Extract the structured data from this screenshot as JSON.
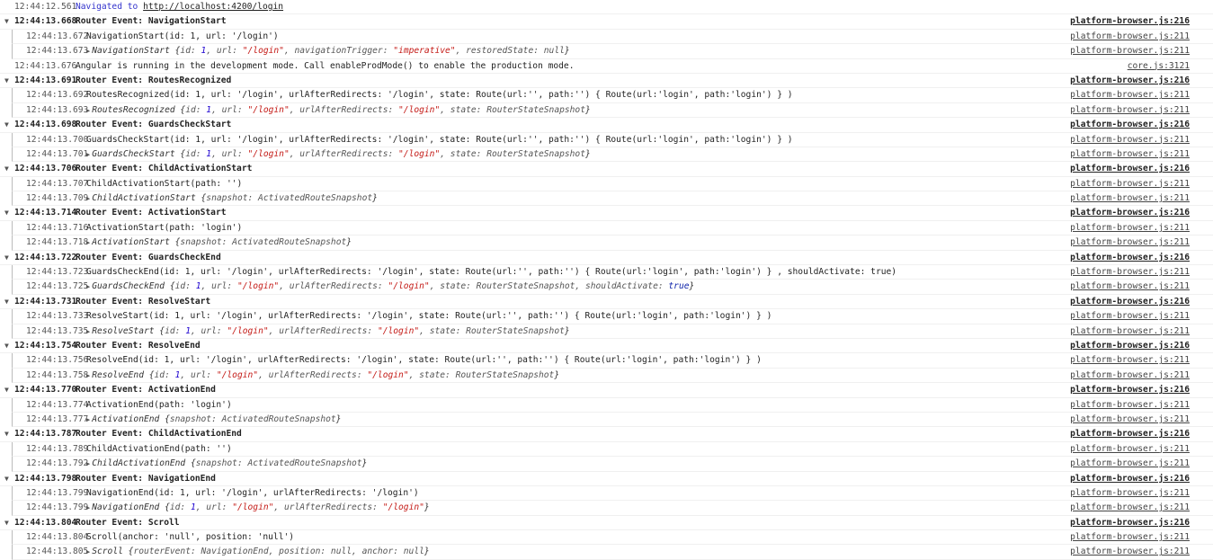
{
  "nav": {
    "ts": "12:44:12.561",
    "text": "Navigated to ",
    "url": "http://localhost:4200/login"
  },
  "rows": [
    {
      "kind": "grp",
      "ts": "12:44:13.668",
      "title": "Router Event: NavigationStart",
      "src": "platform-browser.js:216"
    },
    {
      "kind": "child",
      "ts": "12:44:13.672",
      "msg": "NavigationStart(id: 1, url: '/login')",
      "src": "platform-browser.js:211"
    },
    {
      "kind": "obj",
      "ts": "12:44:13.673",
      "name": "NavigationStart",
      "parts": [
        [
          "k",
          "id: "
        ],
        [
          "n",
          "1"
        ],
        [
          "k",
          ", url: "
        ],
        [
          "s",
          "\"/login\""
        ],
        [
          "k",
          ", navigationTrigger: "
        ],
        [
          "s",
          "\"imperative\""
        ],
        [
          "k",
          ", restoredState: null"
        ]
      ],
      "src": "platform-browser.js:211"
    },
    {
      "kind": "plain",
      "ts": "12:44:13.676",
      "msg": "Angular is running in the development mode. Call enableProdMode() to enable the production mode.",
      "src": "core.js:3121"
    },
    {
      "kind": "grp",
      "ts": "12:44:13.691",
      "title": "Router Event: RoutesRecognized",
      "src": "platform-browser.js:216"
    },
    {
      "kind": "child",
      "ts": "12:44:13.692",
      "msg": "RoutesRecognized(id: 1, url: '/login', urlAfterRedirects: '/login', state: Route(url:'', path:'') { Route(url:'login', path:'login') } )",
      "src": "platform-browser.js:211"
    },
    {
      "kind": "obj",
      "ts": "12:44:13.693",
      "name": "RoutesRecognized",
      "parts": [
        [
          "k",
          "id: "
        ],
        [
          "n",
          "1"
        ],
        [
          "k",
          ", url: "
        ],
        [
          "s",
          "\"/login\""
        ],
        [
          "k",
          ", urlAfterRedirects: "
        ],
        [
          "s",
          "\"/login\""
        ],
        [
          "k",
          ", state: RouterStateSnapshot"
        ]
      ],
      "src": "platform-browser.js:211"
    },
    {
      "kind": "grp",
      "ts": "12:44:13.698",
      "title": "Router Event: GuardsCheckStart",
      "src": "platform-browser.js:216"
    },
    {
      "kind": "child",
      "ts": "12:44:13.700",
      "msg": "GuardsCheckStart(id: 1, url: '/login', urlAfterRedirects: '/login', state: Route(url:'', path:'') { Route(url:'login', path:'login') } )",
      "src": "platform-browser.js:211"
    },
    {
      "kind": "obj",
      "ts": "12:44:13.701",
      "name": "GuardsCheckStart",
      "parts": [
        [
          "k",
          "id: "
        ],
        [
          "n",
          "1"
        ],
        [
          "k",
          ", url: "
        ],
        [
          "s",
          "\"/login\""
        ],
        [
          "k",
          ", urlAfterRedirects: "
        ],
        [
          "s",
          "\"/login\""
        ],
        [
          "k",
          ", state: RouterStateSnapshot"
        ]
      ],
      "src": "platform-browser.js:211"
    },
    {
      "kind": "grp",
      "ts": "12:44:13.706",
      "title": "Router Event: ChildActivationStart",
      "src": "platform-browser.js:216"
    },
    {
      "kind": "child",
      "ts": "12:44:13.707",
      "msg": "ChildActivationStart(path: '')",
      "src": "platform-browser.js:211"
    },
    {
      "kind": "obj",
      "ts": "12:44:13.709",
      "name": "ChildActivationStart",
      "parts": [
        [
          "k",
          "snapshot: ActivatedRouteSnapshot"
        ]
      ],
      "src": "platform-browser.js:211"
    },
    {
      "kind": "grp",
      "ts": "12:44:13.714",
      "title": "Router Event: ActivationStart",
      "src": "platform-browser.js:216"
    },
    {
      "kind": "child",
      "ts": "12:44:13.716",
      "msg": "ActivationStart(path: 'login')",
      "src": "platform-browser.js:211"
    },
    {
      "kind": "obj",
      "ts": "12:44:13.718",
      "name": "ActivationStart",
      "parts": [
        [
          "k",
          "snapshot: ActivatedRouteSnapshot"
        ]
      ],
      "src": "platform-browser.js:211"
    },
    {
      "kind": "grp",
      "ts": "12:44:13.722",
      "title": "Router Event: GuardsCheckEnd",
      "src": "platform-browser.js:216"
    },
    {
      "kind": "child",
      "ts": "12:44:13.723",
      "msg": "GuardsCheckEnd(id: 1, url: '/login', urlAfterRedirects: '/login', state: Route(url:'', path:'') { Route(url:'login', path:'login') } , shouldActivate: true)",
      "src": "platform-browser.js:211"
    },
    {
      "kind": "obj",
      "ts": "12:44:13.725",
      "name": "GuardsCheckEnd",
      "parts": [
        [
          "k",
          "id: "
        ],
        [
          "n",
          "1"
        ],
        [
          "k",
          ", url: "
        ],
        [
          "s",
          "\"/login\""
        ],
        [
          "k",
          ", urlAfterRedirects: "
        ],
        [
          "s",
          "\"/login\""
        ],
        [
          "k",
          ", state: RouterStateSnapshot, shouldActivate: "
        ],
        [
          "b",
          "true"
        ]
      ],
      "src": "platform-browser.js:211"
    },
    {
      "kind": "grp",
      "ts": "12:44:13.731",
      "title": "Router Event: ResolveStart",
      "src": "platform-browser.js:216"
    },
    {
      "kind": "child",
      "ts": "12:44:13.733",
      "msg": "ResolveStart(id: 1, url: '/login', urlAfterRedirects: '/login', state: Route(url:'', path:'') { Route(url:'login', path:'login') } )",
      "src": "platform-browser.js:211"
    },
    {
      "kind": "obj",
      "ts": "12:44:13.735",
      "name": "ResolveStart",
      "parts": [
        [
          "k",
          "id: "
        ],
        [
          "n",
          "1"
        ],
        [
          "k",
          ", url: "
        ],
        [
          "s",
          "\"/login\""
        ],
        [
          "k",
          ", urlAfterRedirects: "
        ],
        [
          "s",
          "\"/login\""
        ],
        [
          "k",
          ", state: RouterStateSnapshot"
        ]
      ],
      "src": "platform-browser.js:211"
    },
    {
      "kind": "grp",
      "ts": "12:44:13.754",
      "title": "Router Event: ResolveEnd",
      "src": "platform-browser.js:216"
    },
    {
      "kind": "child",
      "ts": "12:44:13.756",
      "msg": "ResolveEnd(id: 1, url: '/login', urlAfterRedirects: '/login', state: Route(url:'', path:'') { Route(url:'login', path:'login') } )",
      "src": "platform-browser.js:211"
    },
    {
      "kind": "obj",
      "ts": "12:44:13.758",
      "name": "ResolveEnd",
      "parts": [
        [
          "k",
          "id: "
        ],
        [
          "n",
          "1"
        ],
        [
          "k",
          ", url: "
        ],
        [
          "s",
          "\"/login\""
        ],
        [
          "k",
          ", urlAfterRedirects: "
        ],
        [
          "s",
          "\"/login\""
        ],
        [
          "k",
          ", state: RouterStateSnapshot"
        ]
      ],
      "src": "platform-browser.js:211"
    },
    {
      "kind": "grp",
      "ts": "12:44:13.770",
      "title": "Router Event: ActivationEnd",
      "src": "platform-browser.js:216"
    },
    {
      "kind": "child",
      "ts": "12:44:13.774",
      "msg": "ActivationEnd(path: 'login')",
      "src": "platform-browser.js:211"
    },
    {
      "kind": "obj",
      "ts": "12:44:13.777",
      "name": "ActivationEnd",
      "parts": [
        [
          "k",
          "snapshot: ActivatedRouteSnapshot"
        ]
      ],
      "src": "platform-browser.js:211"
    },
    {
      "kind": "grp",
      "ts": "12:44:13.787",
      "title": "Router Event: ChildActivationEnd",
      "src": "platform-browser.js:216"
    },
    {
      "kind": "child",
      "ts": "12:44:13.789",
      "msg": "ChildActivationEnd(path: '')",
      "src": "platform-browser.js:211"
    },
    {
      "kind": "obj",
      "ts": "12:44:13.792",
      "name": "ChildActivationEnd",
      "parts": [
        [
          "k",
          "snapshot: ActivatedRouteSnapshot"
        ]
      ],
      "src": "platform-browser.js:211"
    },
    {
      "kind": "grp",
      "ts": "12:44:13.798",
      "title": "Router Event: NavigationEnd",
      "src": "platform-browser.js:216"
    },
    {
      "kind": "child",
      "ts": "12:44:13.799",
      "msg": "NavigationEnd(id: 1, url: '/login', urlAfterRedirects: '/login')",
      "src": "platform-browser.js:211"
    },
    {
      "kind": "obj",
      "ts": "12:44:13.799",
      "name": "NavigationEnd",
      "parts": [
        [
          "k",
          "id: "
        ],
        [
          "n",
          "1"
        ],
        [
          "k",
          ", url: "
        ],
        [
          "s",
          "\"/login\""
        ],
        [
          "k",
          ", urlAfterRedirects: "
        ],
        [
          "s",
          "\"/login\""
        ]
      ],
      "src": "platform-browser.js:211"
    },
    {
      "kind": "grp",
      "ts": "12:44:13.804",
      "title": "Router Event: Scroll",
      "src": "platform-browser.js:216"
    },
    {
      "kind": "child",
      "ts": "12:44:13.804",
      "msg": "Scroll(anchor: 'null', position: 'null')",
      "src": "platform-browser.js:211"
    },
    {
      "kind": "obj",
      "ts": "12:44:13.805",
      "name": "Scroll",
      "parts": [
        [
          "k",
          "routerEvent: NavigationEnd, position: null, anchor: null"
        ]
      ],
      "src": "platform-browser.js:211"
    }
  ]
}
